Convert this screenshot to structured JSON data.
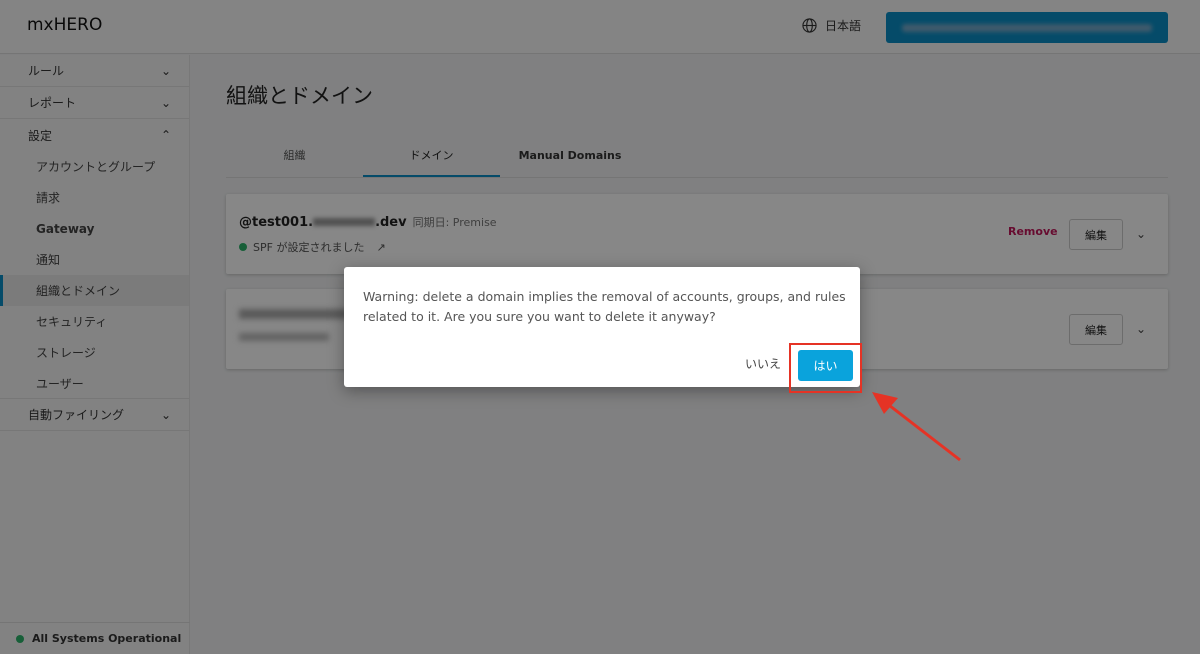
{
  "header": {
    "logo": "mxHERO",
    "language": "日本語"
  },
  "sidebar": {
    "items": [
      {
        "label": "ルール",
        "expanded": false
      },
      {
        "label": "レポート",
        "expanded": false
      },
      {
        "label": "設定",
        "expanded": true
      }
    ],
    "sub_items": [
      "アカウントとグループ",
      "請求",
      "Gateway",
      "通知",
      "組織とドメイン",
      "セキュリティ",
      "ストレージ",
      "ユーザー"
    ],
    "last_item": "自動ファイリング",
    "status": "All Systems Operational"
  },
  "main": {
    "title": "組織とドメイン",
    "tabs": [
      "組織",
      "ドメイン",
      "Manual Domains"
    ],
    "domains": [
      {
        "name": "@test001.",
        "suffix": ".dev",
        "sync": "同期日: Premise",
        "spf": "SPF が設定されました",
        "remove": "Remove",
        "edit": "編集"
      },
      {
        "edit": "編集"
      }
    ]
  },
  "dialog": {
    "message": "Warning: delete a domain implies the removal of accounts, groups, and rules related to it. Are you sure you want to delete it anyway?",
    "no": "いいえ",
    "yes": "はい"
  },
  "colors": {
    "accent": "#0a8fc7",
    "remove": "#c2185b",
    "highlight": "#e53325"
  }
}
